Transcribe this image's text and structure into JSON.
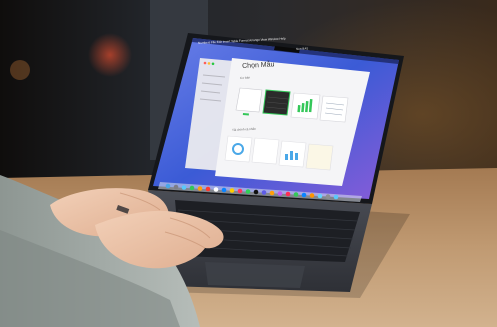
{
  "screen": {
    "window_title": "Chọn Mẫu",
    "menubar_left": "Numbers File Edit Insert Table Format Arrange View Window Help",
    "menubar_right": "Sun 9:41",
    "section_basic": "Cơ bản",
    "section_personal": "Tài chính cá nhân"
  },
  "colors": {
    "wallpaper_blue": "#3b5bd6",
    "accent_green": "#34c759",
    "dark_template": "#2b2b2b"
  }
}
